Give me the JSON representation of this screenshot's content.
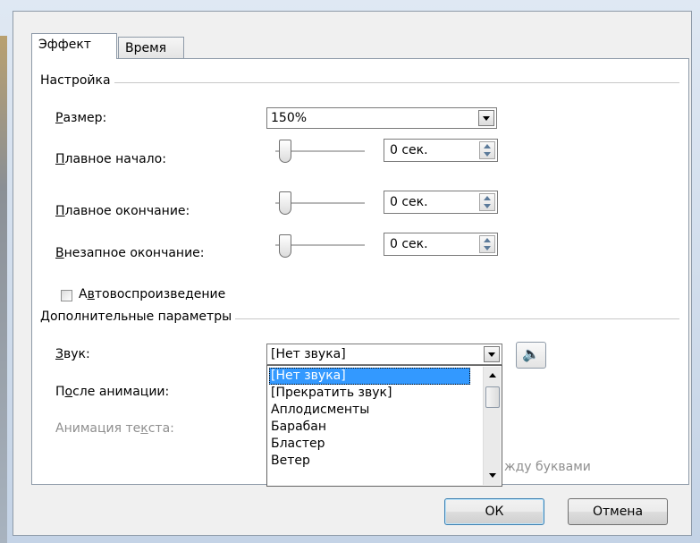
{
  "tabs": [
    {
      "label": "Эффект",
      "active": true
    },
    {
      "label": "Время",
      "active": false
    }
  ],
  "settings": {
    "title": "Настройка",
    "size_label_accel": "Р",
    "size_label_rest": "азмер:",
    "size_value": "150%",
    "smooth_start_label_accel": "П",
    "smooth_start_label_rest": "лавное начало:",
    "smooth_start_value": "0 сек.",
    "smooth_end_label_accel": "П",
    "smooth_end_label_rest": "лавное окончание:",
    "smooth_end_value": "0 сек.",
    "bounce_end_label_accel": "В",
    "bounce_end_label_rest": "незапное окончание:",
    "bounce_end_value": "0 сек.",
    "autoreverse_label_pre": "А",
    "autoreverse_label_accel": "в",
    "autoreverse_label_rest": "товоспроизведение"
  },
  "enhancements": {
    "title": "Дополнительные параметры",
    "sound_label_accel": "З",
    "sound_label_rest": "вук:",
    "sound_value": "[Нет звука]",
    "after_label_pre": "П",
    "after_label_accel": "о",
    "after_label_rest": "сле анимации:",
    "animate_text_label_pre": "Анимация те",
    "animate_text_label_accel": "к",
    "animate_text_label_rest": "ста:",
    "between_letters_partial": "жду буквами",
    "sound_options": [
      "[Нет звука]",
      "[Прекратить звук]",
      "Аплодисменты",
      "Барабан",
      "Бластер",
      "Ветер"
    ]
  },
  "buttons": {
    "ok": "ОК",
    "cancel": "Отмена"
  },
  "icons": {
    "speaker": "🔈"
  },
  "colors": {
    "selection": "#3399ff"
  }
}
